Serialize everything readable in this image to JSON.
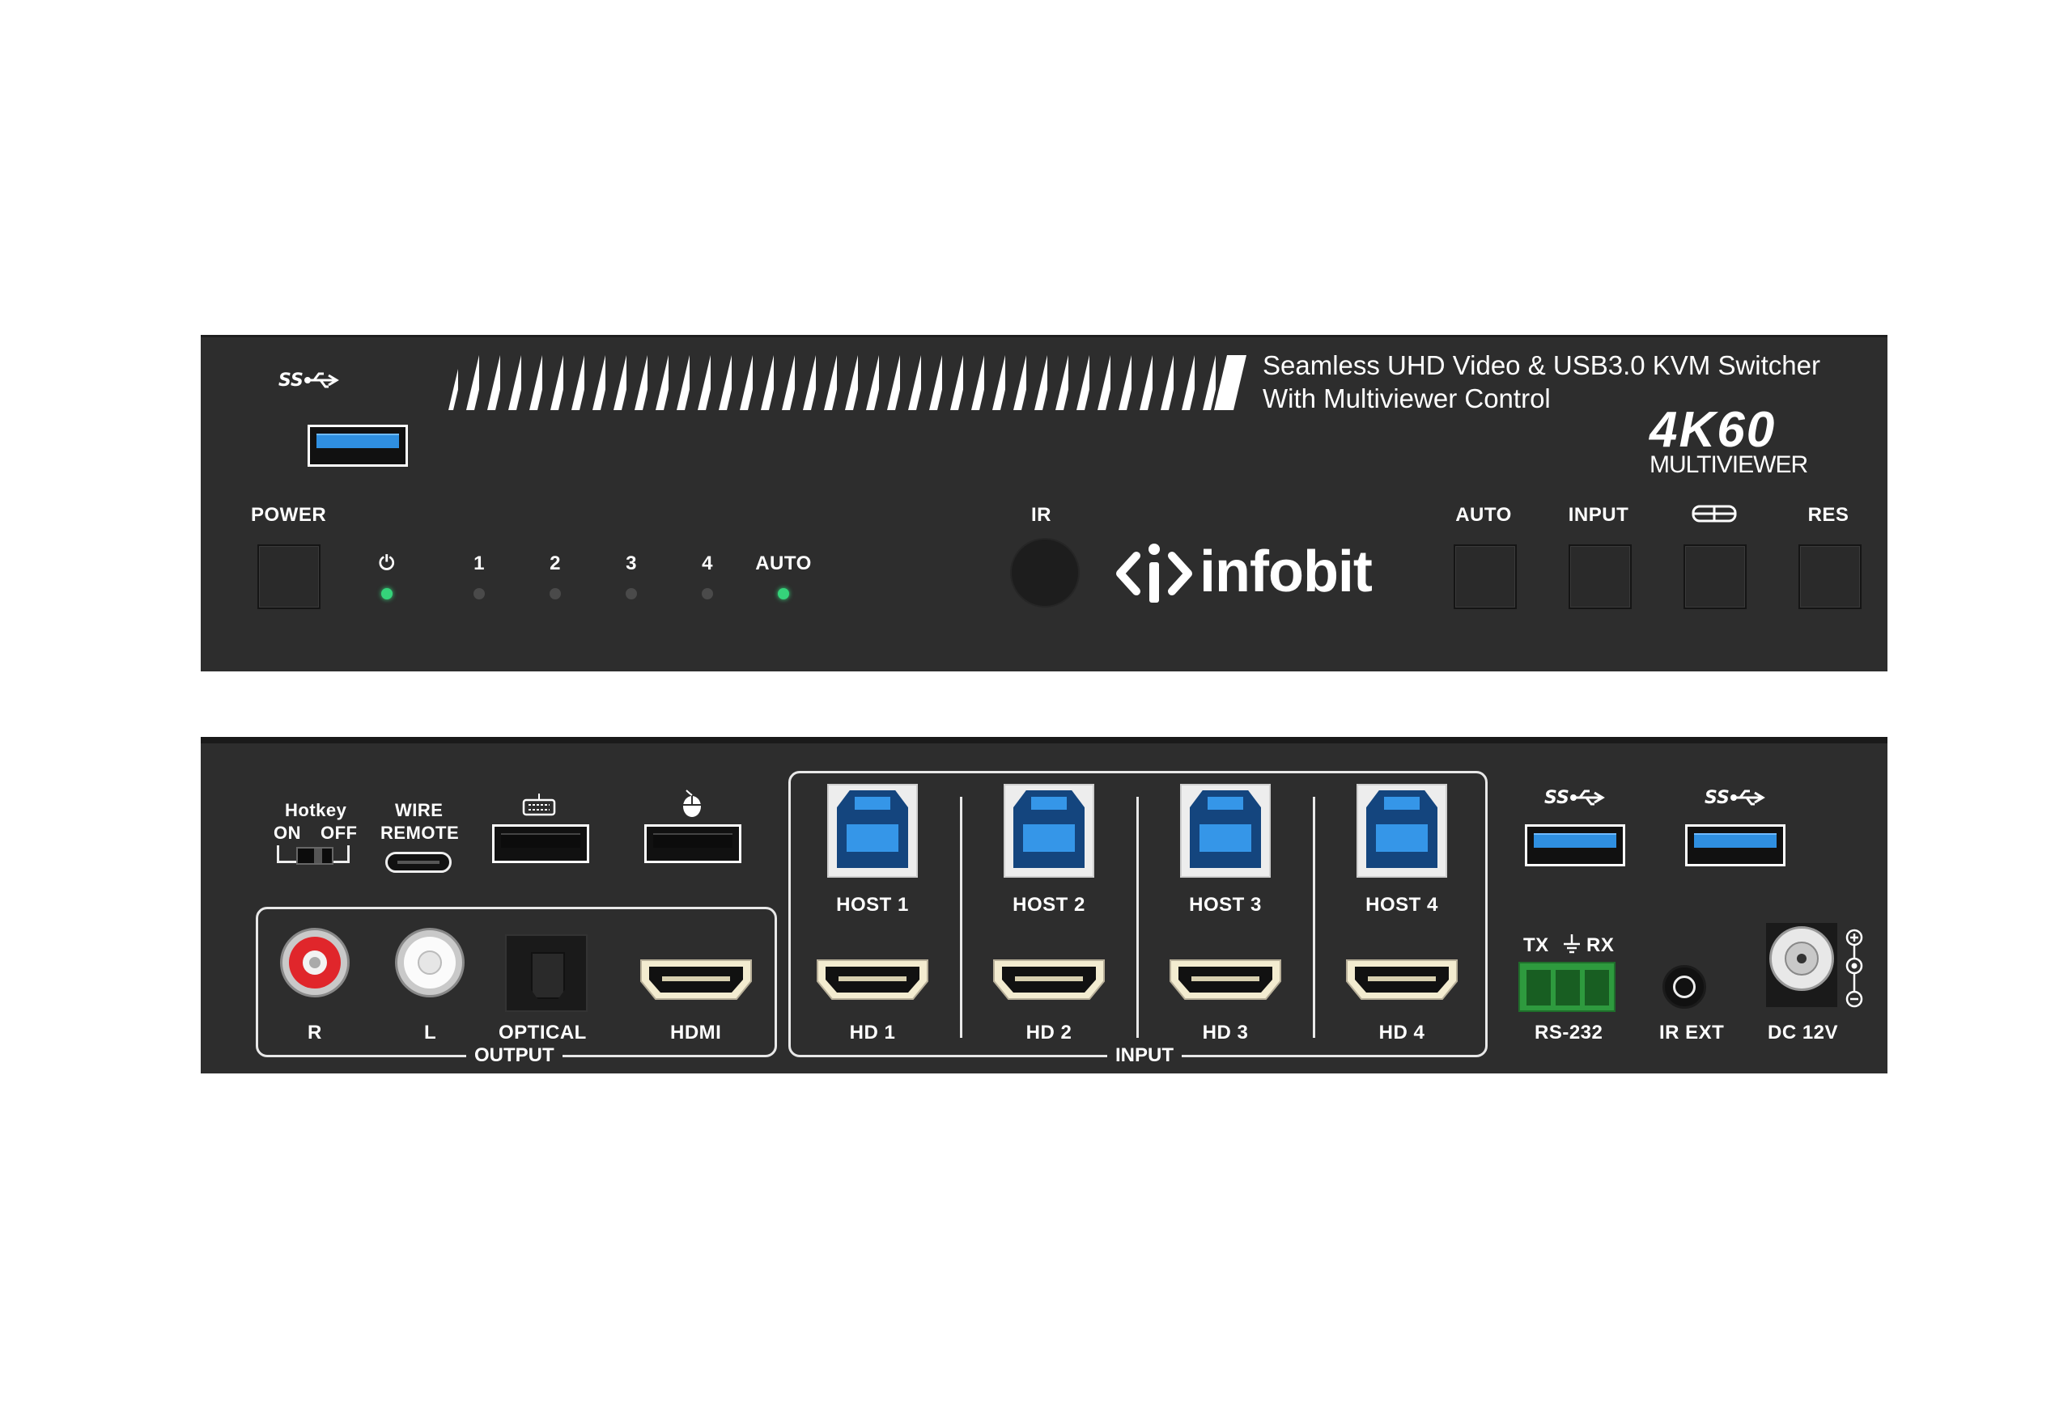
{
  "front": {
    "usb_logo": "ss-usb-icon",
    "product_title_line1": "Seamless UHD Video & USB3.0 KVM Switcher",
    "product_title_line2": "With Multiviewer Control",
    "badge_main": "4K60",
    "badge_sub": "MULTIVIEWER",
    "brand": "infobit",
    "power_label": "POWER",
    "ir_label": "IR",
    "leds": [
      {
        "label": "⏻",
        "on": true
      },
      {
        "label": "1",
        "on": false
      },
      {
        "label": "2",
        "on": false
      },
      {
        "label": "3",
        "on": false
      },
      {
        "label": "4",
        "on": false
      },
      {
        "label": "AUTO",
        "on": true
      }
    ],
    "buttons": [
      {
        "label": "AUTO"
      },
      {
        "label": "INPUT"
      },
      {
        "label": "",
        "icon": "layout-icon"
      },
      {
        "label": "RES"
      }
    ],
    "colors": {
      "panel": "#2d2d2d",
      "led_on": "#35d37a",
      "led_off": "#4a4a4a",
      "usb_blue": "#2f8fe0"
    }
  },
  "rear": {
    "hotkey_label": "Hotkey",
    "hotkey_on": "ON",
    "hotkey_off": "OFF",
    "wire_remote_line1": "WIRE",
    "wire_remote_line2": "REMOTE",
    "keyboard_icon": "keyboard-icon",
    "mouse_icon": "mouse-icon",
    "output": {
      "title": "OUTPUT",
      "ports": [
        "R",
        "L",
        "OPTICAL",
        "HDMI"
      ]
    },
    "input": {
      "title": "INPUT",
      "hosts": [
        "HOST 1",
        "HOST 2",
        "HOST 3",
        "HOST 4"
      ],
      "hdmis": [
        "HD 1",
        "HD 2",
        "HD 3",
        "HD 4"
      ]
    },
    "rs232": {
      "tx": "TX",
      "rx": "RX",
      "label": "RS-232"
    },
    "ir_ext": "IR EXT",
    "dc": "DC 12V"
  }
}
